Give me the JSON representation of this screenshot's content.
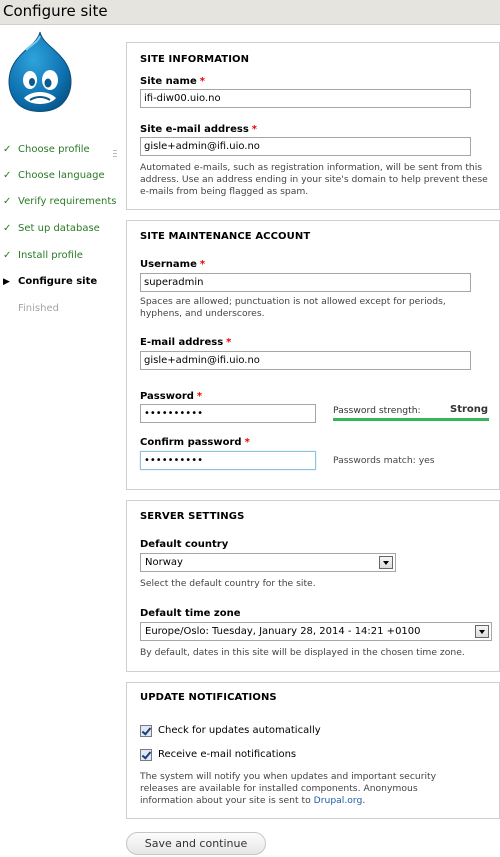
{
  "page": {
    "title": "Configure site"
  },
  "sidebar": {
    "items": [
      {
        "label": "Choose profile",
        "state": "done",
        "mark": "✓"
      },
      {
        "label": "Choose language",
        "state": "done",
        "mark": "✓"
      },
      {
        "label": "Verify requirements",
        "state": "done",
        "mark": "✓"
      },
      {
        "label": "Set up database",
        "state": "done",
        "mark": "✓"
      },
      {
        "label": "Install profile",
        "state": "done",
        "mark": "✓"
      },
      {
        "label": "Configure site",
        "state": "active",
        "mark": "▶"
      },
      {
        "label": "Finished",
        "state": "pending",
        "mark": ""
      }
    ]
  },
  "site_information": {
    "legend": "SITE INFORMATION",
    "site_name": {
      "label": "Site name",
      "required": "*",
      "value": "ifi-diw00.uio.no"
    },
    "site_mail": {
      "label": "Site e-mail address",
      "required": "*",
      "value": "gisle+admin@ifi.uio.no"
    },
    "mail_desc": "Automated e-mails, such as registration information, will be sent from this address. Use an address ending in your site's domain to help prevent these e-mails from being flagged as spam."
  },
  "account": {
    "legend": "SITE MAINTENANCE ACCOUNT",
    "username": {
      "label": "Username",
      "required": "*",
      "value": "superadmin"
    },
    "username_desc": "Spaces are allowed; punctuation is not allowed except for periods, hyphens, and underscores.",
    "email": {
      "label": "E-mail address",
      "required": "*",
      "value": "gisle+admin@ifi.uio.no"
    },
    "password": {
      "label": "Password",
      "required": "*",
      "value": "secretpass"
    },
    "strength_label": "Password strength:",
    "strength_value": "Strong",
    "strength_fraction": 1.0,
    "confirm": {
      "label": "Confirm password",
      "required": "*",
      "value": "secretpass"
    },
    "match_text": "Passwords match: yes"
  },
  "server": {
    "legend": "SERVER SETTINGS",
    "country": {
      "label": "Default country",
      "value": "Norway"
    },
    "country_desc": "Select the default country for the site.",
    "timezone": {
      "label": "Default time zone",
      "value": "Europe/Oslo: Tuesday, January 28, 2014 - 14:21 +0100"
    },
    "timezone_desc": "By default, dates in this site will be displayed in the chosen time zone."
  },
  "updates": {
    "legend": "UPDATE NOTIFICATIONS",
    "check_label": "Check for updates automatically",
    "check_checked": true,
    "email_label": "Receive e-mail notifications",
    "email_checked": true,
    "desc_text": "The system will notify you when updates and important security releases are available for installed components. Anonymous information about your site is sent to ",
    "desc_link": "Drupal.org",
    "desc_end": "."
  },
  "actions": {
    "submit": "Save and continue"
  },
  "colors": {
    "done": "#2a7a26",
    "required": "#e00000",
    "strength": "#3ab45a",
    "link": "#1a5fa6"
  }
}
